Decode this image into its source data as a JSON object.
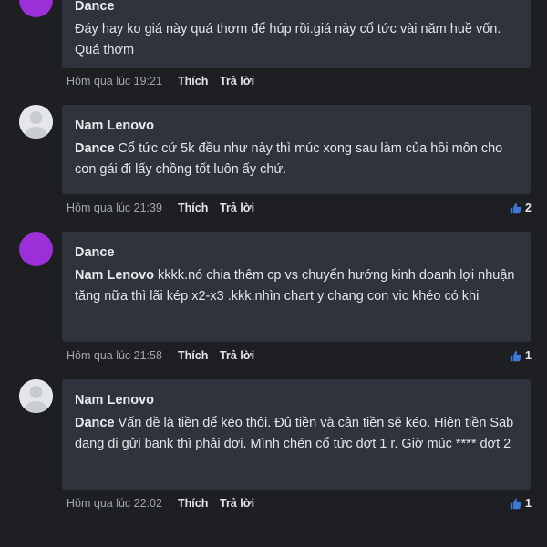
{
  "comments": [
    {
      "author": "Dance",
      "mention": "",
      "text": "Đáy hay ko giá này quá thơm để húp rồi.giá này cổ tức vài năm huề vốn. Quá thơm",
      "time": "Hôm qua lúc 19:21",
      "like_label": "Thích",
      "reply_label": "Trả lời",
      "likes": "",
      "avatar": "purple"
    },
    {
      "author": "Nam Lenovo",
      "mention": "Dance",
      "text": " Cổ tức cứ 5k đều như này thì múc xong sau làm của hồi môn cho con gái đi lấy chồng tốt luôn ấy chứ.",
      "time": "Hôm qua lúc 21:39",
      "like_label": "Thích",
      "reply_label": "Trả lời",
      "likes": "2",
      "avatar": "default"
    },
    {
      "author": "Dance",
      "mention": "Nam Lenovo",
      "text": " kkkk.nó chia thêm cp vs chuyển hướng kinh doanh lợi nhuận tăng nữa thì lãi kép x2-x3 .kkk.nhìn chart y chang con vic khéo có khi",
      "time": "Hôm qua lúc 21:58",
      "like_label": "Thích",
      "reply_label": "Trả lời",
      "likes": "1",
      "avatar": "purple"
    },
    {
      "author": "Nam Lenovo",
      "mention": "Dance",
      "text": " Vấn đề là tiền để kéo thôi. Đủ tiền và cần tiền sẽ kéo. Hiện tiền Sab đang đi gửi bank thì phải đợi. Mình chén cổ tức đợt 1 r. Giờ múc **** đợt 2",
      "time": "Hôm qua lúc 22:02",
      "like_label": "Thích",
      "reply_label": "Trả lời",
      "likes": "1",
      "avatar": "default"
    }
  ],
  "colors": {
    "background": "#1d1f23",
    "bubble": "#2f333b",
    "avatar_purple": "#9b2fd8",
    "like_icon": "#3b78d8"
  },
  "icons": {
    "like": "thumbs-up-icon",
    "avatar_default": "default-user-icon"
  }
}
